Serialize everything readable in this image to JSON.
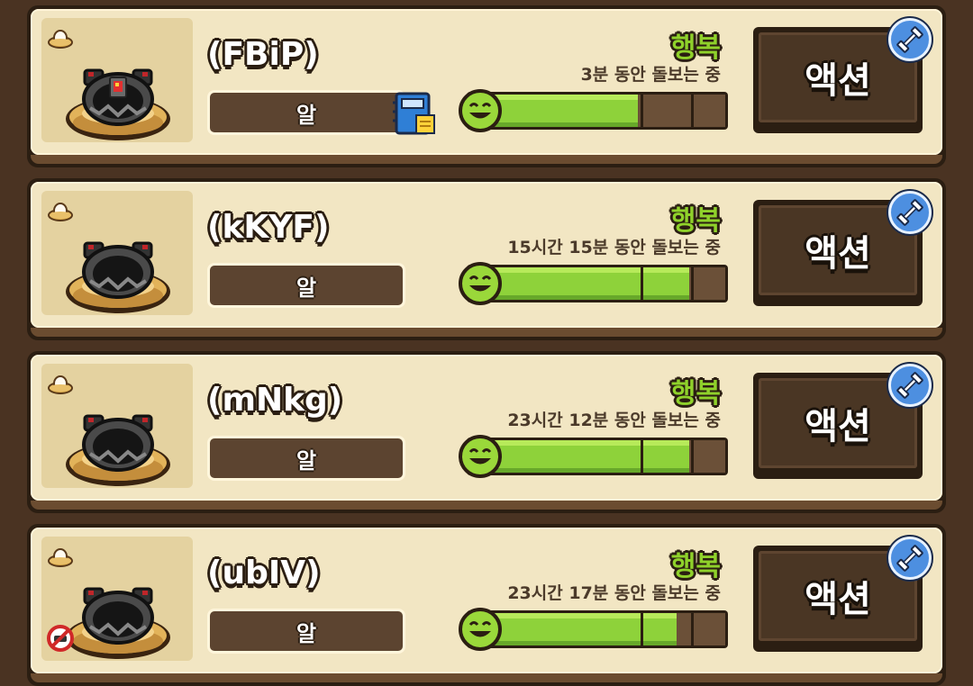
{
  "action_label": "액션",
  "type_label": "알",
  "mood_color": "#8fd12b",
  "bar_fill_color": "#8ed23a",
  "monsters": [
    {
      "name": "(FBiP)",
      "type": "알",
      "mood": "행복",
      "care_time": "3분 동안 돌보는 중",
      "happiness": 0.66,
      "has_book_icon": true,
      "has_no_icon": false,
      "crystal": "red"
    },
    {
      "name": "(kKYF)",
      "type": "알",
      "mood": "행복",
      "care_time": "15시간 15분 동안 돌보는 중",
      "happiness": 0.86,
      "has_book_icon": false,
      "has_no_icon": false,
      "crystal": "none"
    },
    {
      "name": "(mNkg)",
      "type": "알",
      "mood": "행복",
      "care_time": "23시간 12분 동안 돌보는 중",
      "happiness": 0.86,
      "has_book_icon": false,
      "has_no_icon": false,
      "crystal": "none"
    },
    {
      "name": "(ubIV)",
      "type": "알",
      "mood": "행복",
      "care_time": "23시간 17분 동안 돌보는 중",
      "happiness": 0.81,
      "has_book_icon": false,
      "has_no_icon": true,
      "crystal": "none"
    }
  ]
}
